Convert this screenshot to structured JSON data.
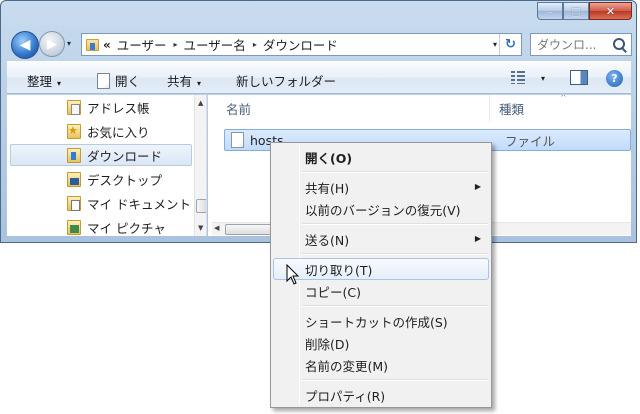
{
  "window": {
    "caption_buttons": {
      "minimize": "–",
      "maximize": "□",
      "close": "✕"
    }
  },
  "nav": {
    "back_glyph": "◀",
    "forward_glyph": "▶",
    "history_glyph": "▾"
  },
  "address": {
    "chevron": "«",
    "crumbs": [
      "ユーザー",
      "ユーザー名",
      "ダウンロード"
    ],
    "separator": "▸",
    "dropdown_glyph": "▾",
    "refresh_glyph": "↻"
  },
  "search": {
    "placeholder": "ダウンロ..."
  },
  "toolbar": {
    "organize": "整理",
    "open": "開く",
    "share": "共有",
    "new_folder": "新しいフォルダー",
    "drop_glyph": "▾",
    "help_glyph": "?"
  },
  "navpane": {
    "items": [
      {
        "label": "アドレス帳",
        "icon": "contacts-icon"
      },
      {
        "label": "お気に入り",
        "icon": "favorites-icon"
      },
      {
        "label": "ダウンロード",
        "icon": "downloads-icon",
        "selected": true
      },
      {
        "label": "デスクトップ",
        "icon": "desktop-icon"
      },
      {
        "label": "マイ ドキュメント",
        "icon": "documents-icon"
      },
      {
        "label": "マイ ピクチャ",
        "icon": "pictures-icon"
      }
    ],
    "scroll_up": "▲",
    "scroll_down": "▼"
  },
  "content": {
    "columns": {
      "name": "名前",
      "type": "種類"
    },
    "sort_glyph": "^",
    "files": [
      {
        "name": "hosts",
        "type": "ファイル"
      }
    ],
    "scroll_left": "◀"
  },
  "context_menu": {
    "items": [
      {
        "label": "開く(O)",
        "bold": true
      },
      {
        "label": "共有(H)",
        "submenu": true
      },
      {
        "label": "以前のバージョンの復元(V)"
      },
      {
        "label": "送る(N)",
        "submenu": true
      },
      {
        "label": "切り取り(T)",
        "hover": true
      },
      {
        "label": "コピー(C)"
      },
      {
        "label": "ショートカットの作成(S)"
      },
      {
        "label": "削除(D)"
      },
      {
        "label": "名前の変更(M)"
      },
      {
        "label": "プロパティ(R)"
      }
    ],
    "submenu_glyph": "▶"
  },
  "colors": {
    "selection": "#c1dbfc",
    "window_frame": "#b4cbe4",
    "close_button": "#cf5a45"
  }
}
